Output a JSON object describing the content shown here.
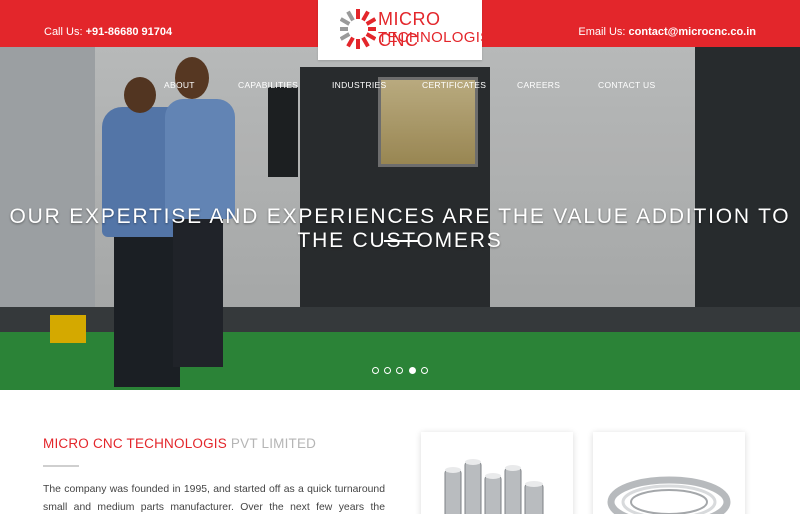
{
  "topbar": {
    "call_label": "Call Us: ",
    "call_number": "+91-86680 91704",
    "email_label": "Email Us: ",
    "email_address": "contact@microcnc.co.in"
  },
  "logo": {
    "line1": "MICRO CNC",
    "line2": "TECHNOLOGIS"
  },
  "nav": {
    "items": [
      {
        "label": "ABOUT"
      },
      {
        "label": "CAPABILITIES"
      },
      {
        "label": "INDUSTRIES"
      },
      {
        "label": "CERTIFICATES"
      },
      {
        "label": "CAREERS"
      },
      {
        "label": "CONTACT US"
      }
    ]
  },
  "hero": {
    "headline": "OUR EXPERTISE AND EXPERIENCES ARE THE VALUE ADDITION TO THE CUSTOMERS",
    "slide_count": 5,
    "active_slide": 4
  },
  "content": {
    "title_main": "MICRO CNC TECHNOLOGIS",
    "title_sub": " PVT LIMITED",
    "about_text": "The company was founded in 1995, and started off as a quick turnaround small and medium parts manufacturer. Over the next few years the business grew and"
  },
  "colors": {
    "brand_red": "#e3262b",
    "floor_green": "#2f8f3c"
  }
}
